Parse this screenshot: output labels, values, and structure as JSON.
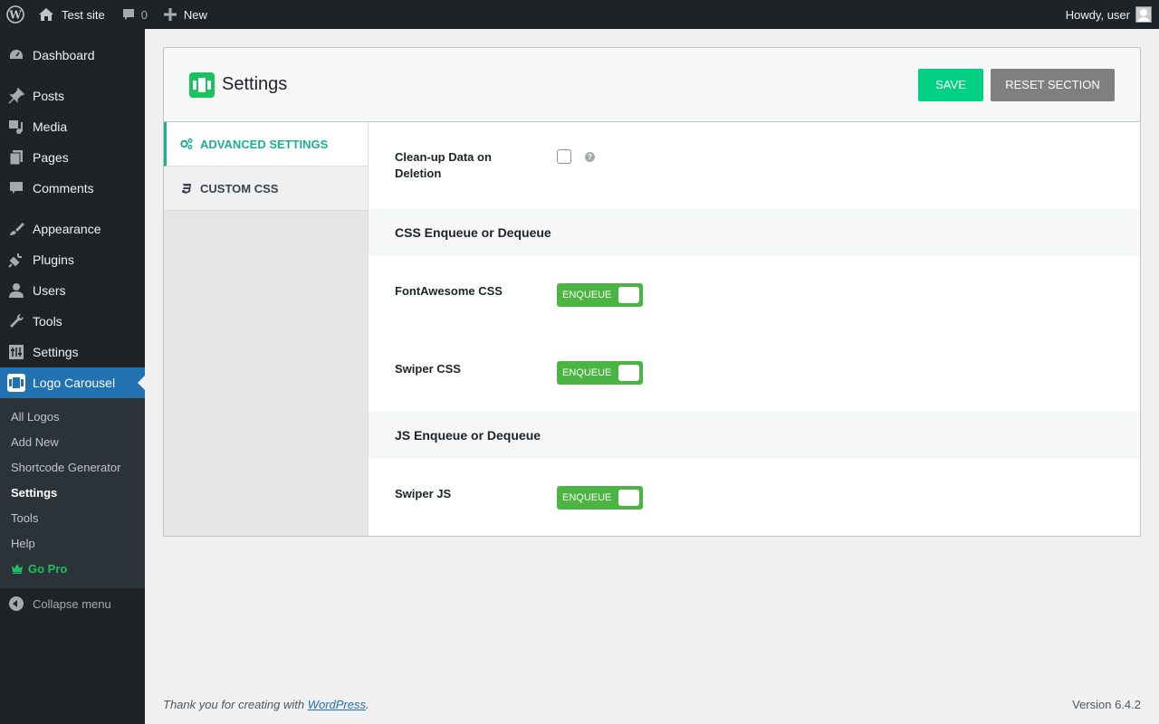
{
  "adminbar": {
    "site_name": "Test site",
    "comment_count": "0",
    "new_label": "New",
    "howdy": "Howdy, user"
  },
  "sidebar": {
    "items": [
      {
        "label": "Dashboard",
        "icon": "dashboard-icon"
      },
      {
        "label": "Posts",
        "icon": "pin-icon"
      },
      {
        "label": "Media",
        "icon": "media-icon"
      },
      {
        "label": "Pages",
        "icon": "pages-icon"
      },
      {
        "label": "Comments",
        "icon": "comment-icon"
      },
      {
        "label": "Appearance",
        "icon": "brush-icon"
      },
      {
        "label": "Plugins",
        "icon": "plugin-icon"
      },
      {
        "label": "Users",
        "icon": "user-icon"
      },
      {
        "label": "Tools",
        "icon": "wrench-icon"
      },
      {
        "label": "Settings",
        "icon": "settings-icon"
      },
      {
        "label": "Logo Carousel",
        "icon": "carousel-icon"
      }
    ],
    "submenu": [
      "All Logos",
      "Add New",
      "Shortcode Generator",
      "Settings",
      "Tools",
      "Help",
      "Go Pro"
    ],
    "collapse_label": "Collapse menu"
  },
  "panel": {
    "title": "Settings",
    "save_label": "SAVE",
    "reset_label": "RESET SECTION",
    "tabs": [
      {
        "label": "ADVANCED SETTINGS"
      },
      {
        "label": "CUSTOM CSS"
      }
    ],
    "cleanup_label": "Clean-up Data on Deletion",
    "help_glyph": "?",
    "css_section": "CSS Enqueue or Dequeue",
    "fontawesome_label": "FontAwesome CSS",
    "swiper_css_label": "Swiper CSS",
    "js_section": "JS Enqueue or Dequeue",
    "swiper_js_label": "Swiper JS",
    "toggle_label": "ENQUEUE"
  },
  "footer": {
    "thanks_prefix": "Thank you for creating with ",
    "link": "WordPress",
    "thanks_suffix": ".",
    "version": "Version 6.4.2"
  },
  "colors": {
    "accent_green": "#1ac35e",
    "save_green": "#00d084",
    "toggle_green": "#4bb543",
    "tab_active": "#1ab190",
    "wp_blue": "#2271b1"
  }
}
